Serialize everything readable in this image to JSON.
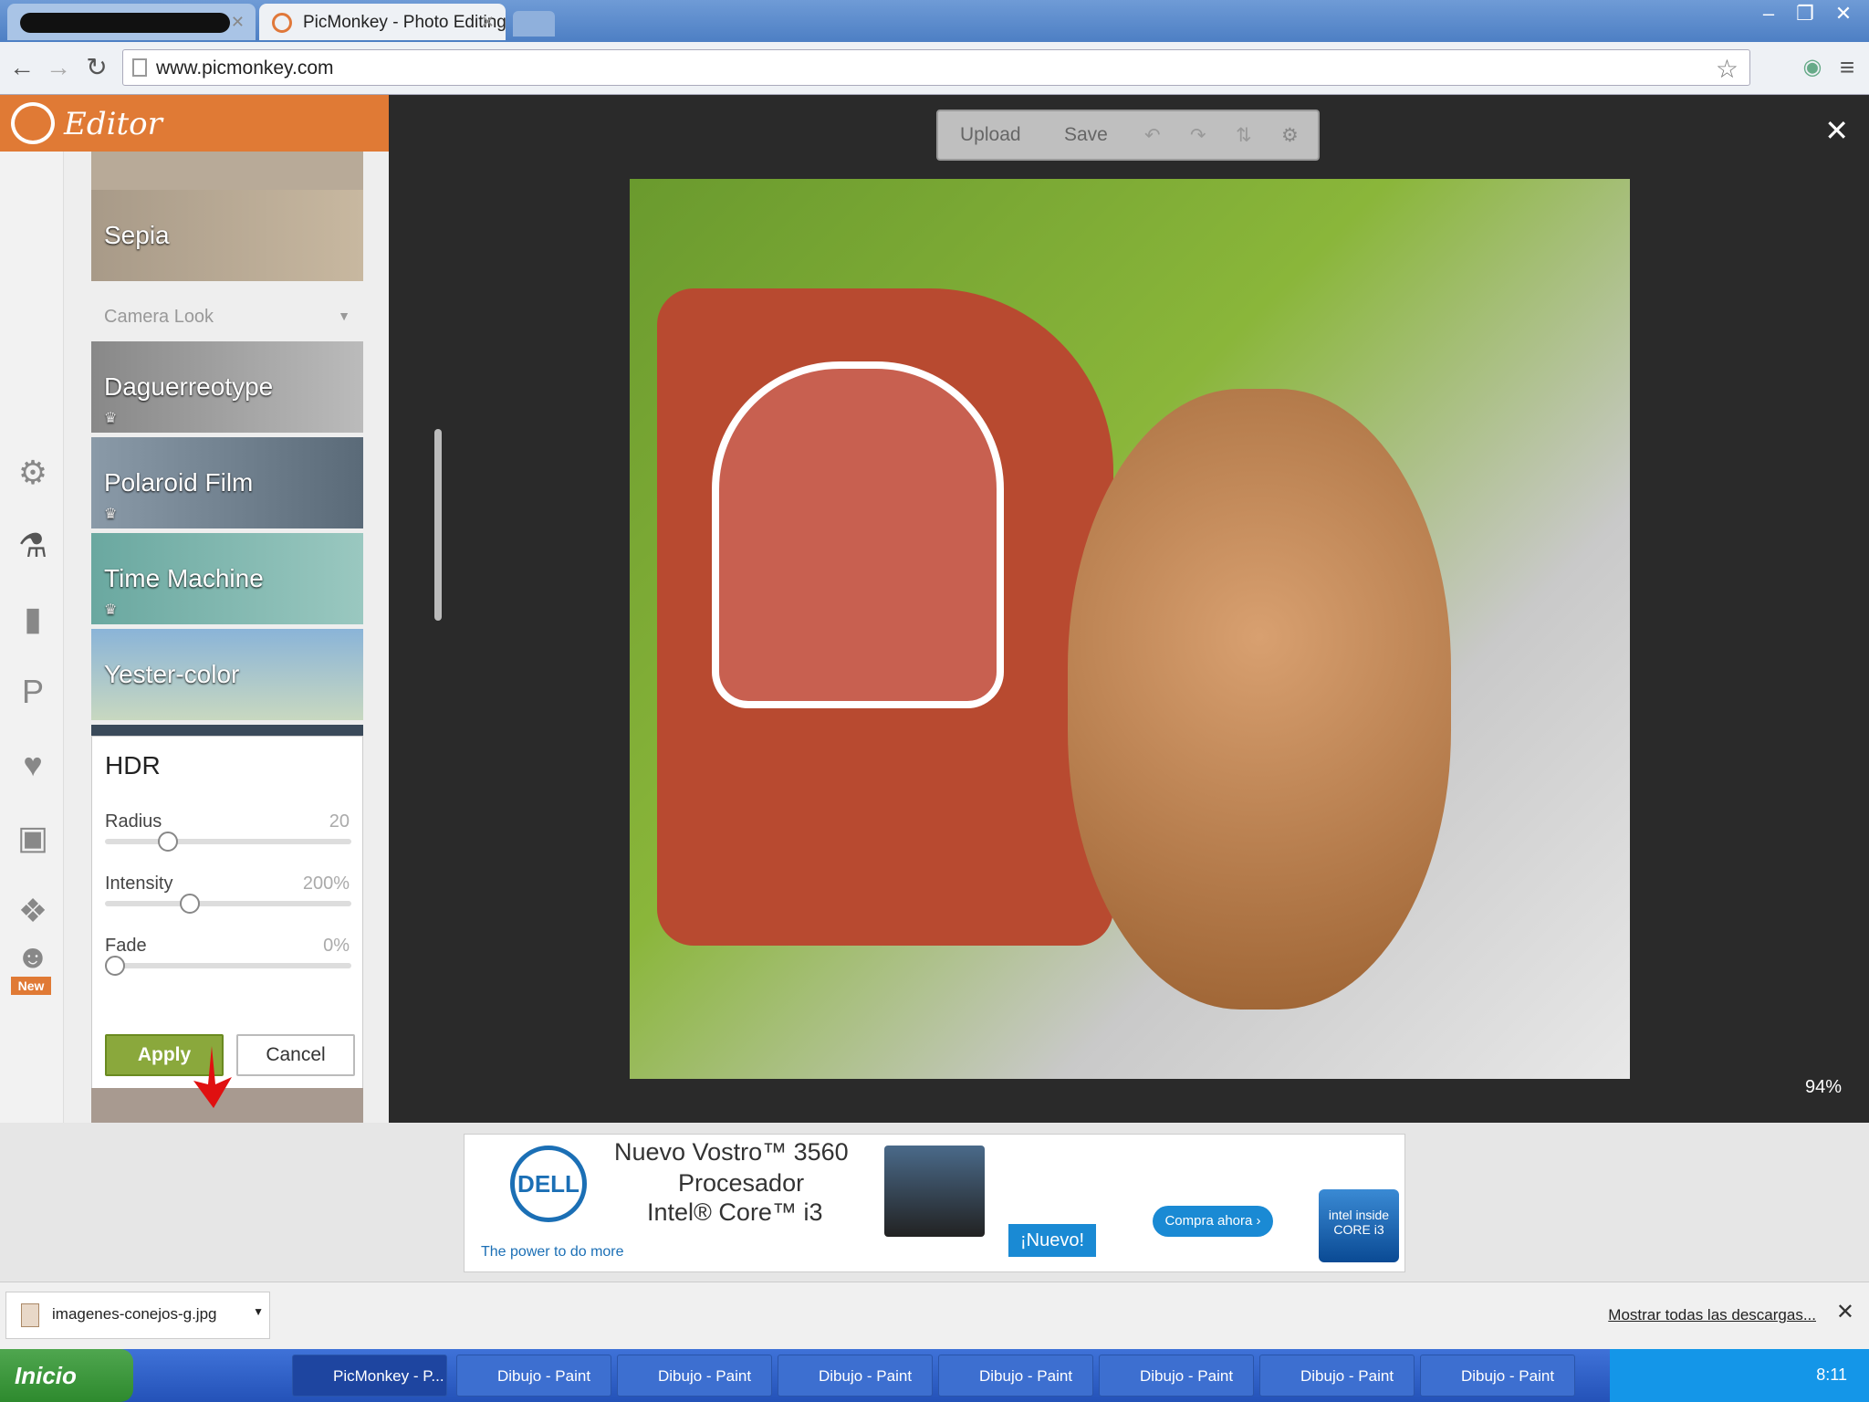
{
  "browser": {
    "tabs": [
      {
        "label": ""
      },
      {
        "label": "PicMonkey - Photo Editing Ma"
      }
    ],
    "url": "www.picmonkey.com"
  },
  "editor": {
    "title": "Editor",
    "sections": {
      "camera_look": "Camera Look"
    },
    "effects": [
      {
        "label": "Sepia"
      },
      {
        "label": "Daguerreotype"
      },
      {
        "label": "Polaroid Film"
      },
      {
        "label": "Time Machine"
      },
      {
        "label": "Yester-color"
      }
    ],
    "hdr": {
      "title": "HDR",
      "radius_label": "Radius",
      "radius_value": "20",
      "intensity_label": "Intensity",
      "intensity_value": "200%",
      "fade_label": "Fade",
      "fade_value": "0%",
      "apply": "Apply",
      "cancel": "Cancel"
    },
    "new_badge": "New"
  },
  "canvas": {
    "upload": "Upload",
    "save": "Save",
    "zoom": "94%"
  },
  "ad": {
    "dell": "DELL",
    "tagline": "The power to do more",
    "line1": "Nuevo Vostro™ 3560",
    "line2": "Procesador",
    "line3": "Intel® Core™ i3",
    "nuevo": "¡Nuevo!",
    "cta": "Compra ahora ›",
    "intel": "intel inside CORE i3"
  },
  "downloads": {
    "file": "imagenes-conejos-g.jpg",
    "show_all": "Mostrar todas las descargas..."
  },
  "taskbar": {
    "start": "Inicio",
    "items": [
      {
        "label": "PicMonkey - P..."
      },
      {
        "label": "Dibujo - Paint"
      },
      {
        "label": "Dibujo - Paint"
      },
      {
        "label": "Dibujo - Paint"
      },
      {
        "label": "Dibujo - Paint"
      },
      {
        "label": "Dibujo - Paint"
      },
      {
        "label": "Dibujo - Paint"
      },
      {
        "label": "Dibujo - Paint"
      }
    ],
    "clock": "8:11"
  },
  "colors": {
    "accent": "#e07a35",
    "apply": "#8aa83c",
    "taskbar": "#2452b8"
  }
}
